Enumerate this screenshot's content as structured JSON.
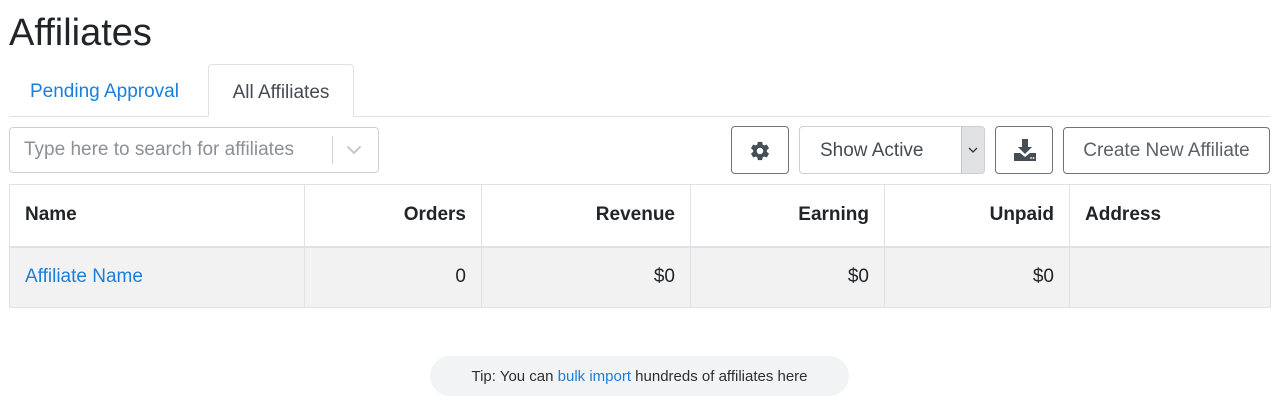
{
  "page": {
    "title": "Affiliates"
  },
  "tabs": [
    {
      "label": "Pending Approval",
      "active": false
    },
    {
      "label": "All Affiliates",
      "active": true
    }
  ],
  "search": {
    "placeholder": "Type here to search for affiliates",
    "value": ""
  },
  "toolbar": {
    "settings_icon": "gear-icon",
    "filter_selected": "Show Active",
    "download_icon": "download-icon",
    "create_label": "Create New Affiliate"
  },
  "table": {
    "columns": [
      "Name",
      "Orders",
      "Revenue",
      "Earning",
      "Unpaid",
      "Address"
    ],
    "rows": [
      {
        "name": "Affiliate Name",
        "orders": "0",
        "revenue": "$0",
        "earning": "$0",
        "unpaid": "$0",
        "address": ""
      }
    ]
  },
  "tip": {
    "prefix": "Tip: You can ",
    "link": "bulk import",
    "suffix": " hundreds of affiliates here"
  },
  "colors": {
    "link": "#1a7fdc",
    "row_background": "#f2f2f2",
    "tip_background": "#f1f3f4"
  }
}
